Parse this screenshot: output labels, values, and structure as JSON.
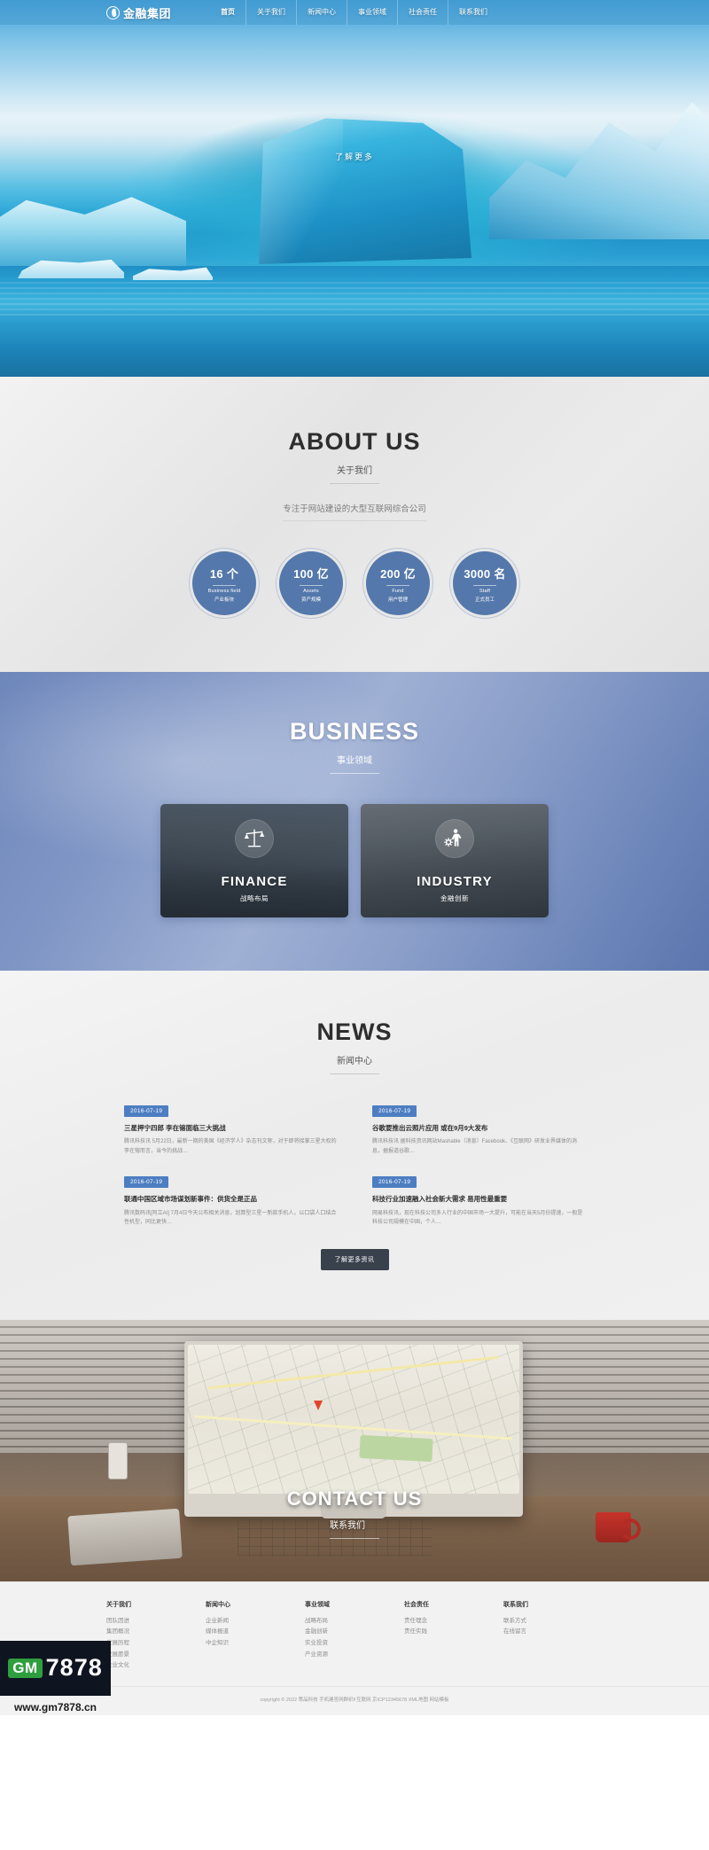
{
  "site": {
    "brand": "金融集团",
    "brand_icon": "flame-drop-logo-icon"
  },
  "nav": {
    "items": [
      {
        "label": "首页",
        "active": true
      },
      {
        "label": "关于我们",
        "active": false
      },
      {
        "label": "新闻中心",
        "active": false
      },
      {
        "label": "事业领域",
        "active": false
      },
      {
        "label": "社会责任",
        "active": false
      },
      {
        "label": "联系我们",
        "active": false
      }
    ]
  },
  "hero": {
    "cta_label": "了解更多"
  },
  "about": {
    "title_en": "ABOUT US",
    "title_cn": "关于我们",
    "subtitle": "专注于网站建设的大型互联网综合公司",
    "stats": [
      {
        "number": "16 个",
        "en": "Business field",
        "cn": "产业板块"
      },
      {
        "number": "100 亿",
        "en": "Assets",
        "cn": "资产规模"
      },
      {
        "number": "200 亿",
        "en": "Fund",
        "cn": "用户管理"
      },
      {
        "number": "3000 名",
        "en": "Staff",
        "cn": "正式员工"
      }
    ]
  },
  "business": {
    "title_en": "BUSINESS",
    "title_cn": "事业领域",
    "cards": [
      {
        "name_en": "FINANCE",
        "name_cn": "战略布局",
        "icon": "balance-scale-icon"
      },
      {
        "name_en": "INDUSTRY",
        "name_cn": "金融创新",
        "icon": "people-gear-icon"
      }
    ]
  },
  "news": {
    "title_en": "NEWS",
    "title_cn": "新闻中心",
    "more_label": "了解更多资讯",
    "left": [
      {
        "date": "2016-07-19",
        "headline": "三星押宁四郎 李在镕面临三大挑战",
        "body": "腾讯科技讯 5月22日，最新一期的美国《经济学人》杂志刊文称，对于即将接掌三星大权的李在镕而言，当今的挑战…"
      },
      {
        "date": "2016-07-19",
        "headline": "联通中国区域市场谋划新事件：供货全是正品",
        "body": "腾讯数码讯[阿立AI] 7月4日今天公布相关消息，划算型三星一新款手机人，以口袋人口结合性机型，同比更快…"
      }
    ],
    "right": [
      {
        "date": "2016-07-19",
        "headline": "谷歌要推出云照片应用 或在9月9大发布",
        "body": "腾讯科技讯 据科技资讯网站Mashable（消息）Facebook、《互联网》研发业界媒体的消息，据报道谷歌…"
      },
      {
        "date": "2016-07-19",
        "headline": "科技行业加速融入社会新大需求 易用性最重要",
        "body": "网易科技讯，现在科技公司多入行业的中国市场一大提升，可能在当天5月份提速，一般是科技公司规模在中国，个人…"
      }
    ]
  },
  "contact": {
    "title_en": "CONTACT US",
    "title_cn": "联系我们"
  },
  "footer": {
    "columns": [
      {
        "heading": "关于我们",
        "links": [
          "团队因进",
          "集团概况",
          "发展历程",
          "发展愿景",
          "企业文化"
        ]
      },
      {
        "heading": "新闻中心",
        "links": [
          "企业新闻",
          "媒体报道",
          "中企知识"
        ]
      },
      {
        "heading": "事业领域",
        "links": [
          "战略布局",
          "金融创新",
          "实业投资",
          "产业资源"
        ]
      },
      {
        "heading": "社会责任",
        "links": [
          "责任理念",
          "责任实践"
        ]
      },
      {
        "heading": "联系我们",
        "links": [
          "联系方式",
          "在线留言"
        ]
      }
    ],
    "copyright": "copyright © 2022 策品科技 手机建答网群织F互联网 京ICP12345678 XML地图 网站模板"
  },
  "watermark": {
    "badge": "GM",
    "number": "7878",
    "url": "www.gm7878.cn",
    "badge_color": "#2f9e3f"
  }
}
